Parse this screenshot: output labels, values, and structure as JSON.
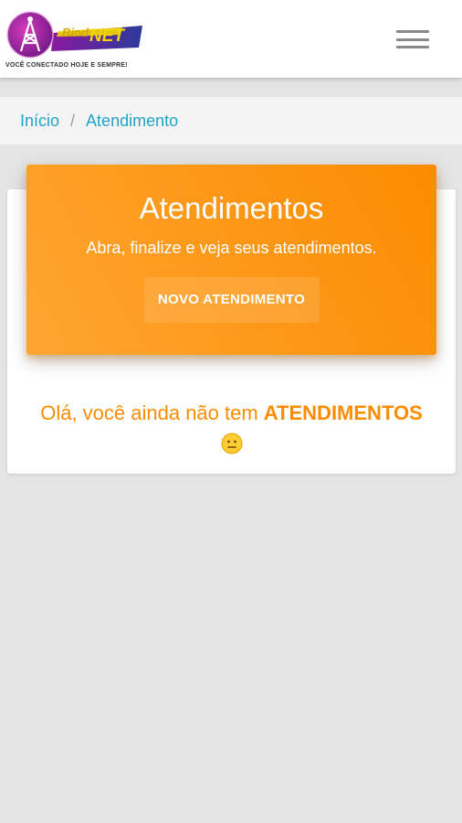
{
  "header": {
    "logo_brand": "BindNET",
    "logo_tagline": "VOCÊ CONECTADO HOJE E SEMPRE!",
    "menu_icon": "hamburger-menu-icon"
  },
  "breadcrumb": {
    "items": [
      {
        "label": "Início"
      },
      {
        "label": "Atendimento"
      }
    ],
    "separator": "/"
  },
  "hero": {
    "title": "Atendimentos",
    "subtitle": "Abra, finalize e veja seus atendimentos.",
    "button_label": "NOVO ATENDIMENTO"
  },
  "empty_state": {
    "prefix": "Olá, você ainda não tem ",
    "highlight": "ATENDIMENTOS",
    "icon": "neutral-face-emoji-icon"
  },
  "colors": {
    "accent": "#fb8c00",
    "link": "#1fa3c7",
    "background": "#e4e4e4"
  }
}
